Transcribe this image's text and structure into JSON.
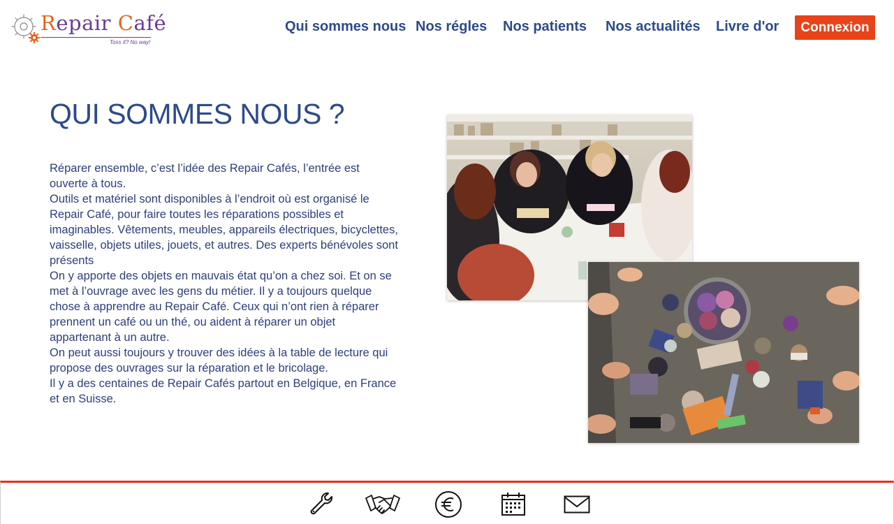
{
  "header": {
    "logo": {
      "name": "Repair Café",
      "tagline": "Toss it? No way!"
    },
    "nav": [
      {
        "label": "Qui sommes nous"
      },
      {
        "label": "Nos régles"
      },
      {
        "label": "Nos patients"
      },
      {
        "label": "Nos actualités"
      },
      {
        "label": "Livre d'or"
      }
    ],
    "login_label": "Connexion",
    "accent_color": "#e8431a"
  },
  "main": {
    "title": "QUI SOMMES NOUS ?",
    "paragraphs": [
      "Réparer ensemble, c’est l’idée des Repair Cafés, l’entrée est ouverte à tous.",
      "Outils et matériel sont disponibles à l’endroit où est organisé le Repair Café, pour faire toutes les réparations possibles et imaginables. Vêtements, meubles, appareils électriques, bicyclettes, vaisselle, objets utiles, jouets, et autres. Des experts bénévoles sont présents",
      "On y apporte des objets en mauvais état qu’on a chez soi. Et on se met à l’ouvrage avec les gens du métier. Il y a toujours quelque chose à apprendre au Repair Café. Ceux qui n’ont rien à réparer prennent un café ou un thé, ou aident à réparer un objet appartenant à un autre.",
      "On peut aussi toujours y trouver des idées à la table de lecture qui propose des ouvrages sur la réparation et le bricolage.",
      "Il y a des centaines de Repair Cafés partout en Belgique, en France et en Suisse."
    ]
  },
  "footer": {
    "icons": [
      "wrench-icon",
      "handshake-icon",
      "euro-icon",
      "calendar-icon",
      "mail-icon"
    ],
    "border_color": "#e8301a"
  }
}
